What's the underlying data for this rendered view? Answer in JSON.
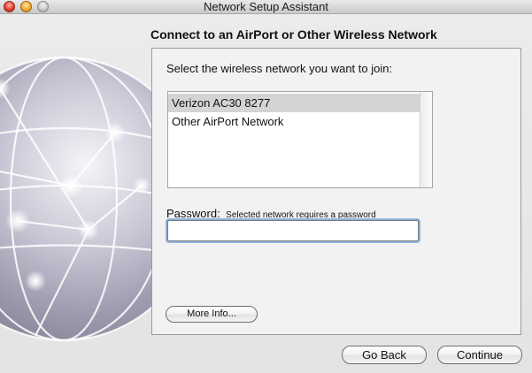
{
  "window": {
    "title": "Network Setup Assistant"
  },
  "header": {
    "heading": "Connect to an AirPort or Other Wireless Network"
  },
  "main": {
    "prompt": "Select the wireless network you want to join:",
    "networks": [
      {
        "label": "Verizon AC30 8277",
        "selected": true
      },
      {
        "label": "Other AirPort Network",
        "selected": false
      }
    ],
    "password": {
      "label": "Password:",
      "note": "Selected network requires a password",
      "value": ""
    },
    "more_info_label": "More Info..."
  },
  "footer": {
    "go_back_label": "Go Back",
    "continue_label": "Continue"
  },
  "icons": {
    "globe": "globe-icon",
    "close": "close-button-icon",
    "minimize": "minimize-button-icon",
    "zoom": "zoom-button-icon"
  },
  "colors": {
    "selection": "#d4d4d4",
    "focus_ring": "#8fb3dc",
    "window_background": "#e8e8e8"
  }
}
